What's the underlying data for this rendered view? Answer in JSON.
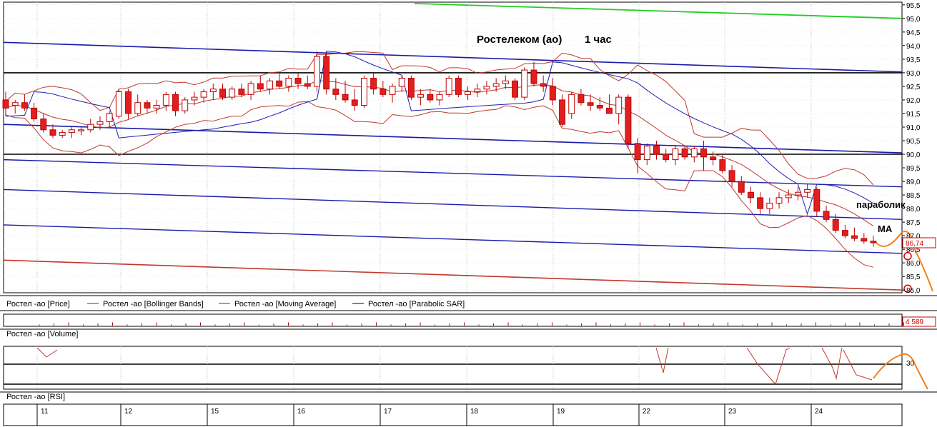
{
  "chart_data": {
    "type": "candlestick",
    "title": "Ростелеком (ао)",
    "timeframe": "1 час",
    "colors": {
      "grid": "#c0c0c0",
      "bb": "#c0392b",
      "sar": "#1f1fb0",
      "channel": "#1a1aa8",
      "level": "#000000",
      "support": "#c0392b",
      "green": "#22cc22",
      "forecast": "#f08020",
      "price_box": "#d00000",
      "up": "#ffffff",
      "down": "#e02020"
    },
    "price_axis": {
      "min": 84.9,
      "max": 95.6,
      "ticks": [
        "95,5",
        "95,0",
        "94,5",
        "94,0",
        "93,5",
        "93,0",
        "92,5",
        "92,0",
        "91,5",
        "91,0",
        "90,5",
        "90,0",
        "89,5",
        "89,0",
        "88,5",
        "88,0",
        "87,5",
        "87,0",
        "86,5",
        "86,0",
        "85,5",
        "85,0"
      ],
      "current_price": "86,74"
    },
    "day_labels": [
      "11",
      "12",
      "15",
      "16",
      "17",
      "18",
      "19",
      "22",
      "23",
      "24"
    ],
    "legend": [
      {
        "label": "Ростел -ао [Price]",
        "color": "#000000"
      },
      {
        "label": "Ростел -ао [Bollinger Bands]",
        "color": "#c0392b"
      },
      {
        "label": "Ростел -ао [Moving Average]",
        "color": "#c0392b"
      },
      {
        "label": "Ростел -ао [Parabolic SAR]",
        "color": "#1f1fb0"
      }
    ],
    "annotations": [
      "параболик",
      "MA"
    ],
    "horizontal_levels": [
      93.0,
      90.0
    ],
    "volume": {
      "label": "Ростел -ао [Volume]",
      "value": "4 589"
    },
    "rsi": {
      "label": "Ростел -ао [RSI]",
      "level": "30"
    },
    "candles": [
      [
        92.0,
        92.3,
        91.4,
        91.7
      ],
      [
        91.8,
        92.0,
        91.5,
        91.9
      ],
      [
        91.9,
        92.2,
        91.6,
        91.7
      ],
      [
        91.7,
        91.9,
        91.2,
        91.3
      ],
      [
        91.3,
        91.5,
        90.8,
        90.9
      ],
      [
        90.9,
        91.1,
        90.6,
        90.7
      ],
      [
        90.7,
        90.9,
        90.6,
        90.8
      ],
      [
        90.8,
        91.0,
        90.6,
        90.9
      ],
      [
        90.9,
        91.0,
        90.7,
        90.9
      ],
      [
        90.9,
        91.3,
        90.8,
        91.1
      ],
      [
        91.1,
        91.4,
        90.9,
        91.2
      ],
      [
        91.2,
        91.6,
        91.0,
        91.5
      ],
      [
        91.4,
        92.4,
        91.3,
        92.3
      ],
      [
        92.3,
        92.4,
        91.3,
        91.5
      ],
      [
        91.5,
        92.2,
        91.4,
        91.9
      ],
      [
        91.9,
        92.0,
        91.5,
        91.7
      ],
      [
        91.7,
        92.0,
        91.5,
        91.8
      ],
      [
        91.8,
        92.3,
        91.6,
        92.2
      ],
      [
        92.2,
        92.3,
        91.4,
        91.6
      ],
      [
        91.6,
        92.1,
        91.5,
        92.0
      ],
      [
        92.0,
        92.3,
        91.8,
        92.1
      ],
      [
        92.1,
        92.4,
        91.9,
        92.3
      ],
      [
        92.3,
        92.6,
        92.0,
        92.4
      ],
      [
        92.4,
        92.6,
        92.0,
        92.1
      ],
      [
        92.1,
        92.5,
        92.0,
        92.4
      ],
      [
        92.4,
        92.6,
        92.1,
        92.2
      ],
      [
        92.2,
        92.7,
        92.0,
        92.6
      ],
      [
        92.6,
        92.9,
        92.3,
        92.4
      ],
      [
        92.4,
        92.8,
        92.2,
        92.7
      ],
      [
        92.7,
        93.0,
        92.4,
        92.5
      ],
      [
        92.5,
        92.9,
        92.3,
        92.8
      ],
      [
        92.8,
        93.0,
        92.4,
        92.6
      ],
      [
        92.6,
        92.9,
        92.4,
        92.5
      ],
      [
        92.5,
        93.8,
        92.3,
        93.6
      ],
      [
        93.6,
        93.7,
        92.2,
        92.4
      ],
      [
        92.4,
        92.8,
        92.0,
        92.2
      ],
      [
        92.2,
        92.7,
        91.9,
        92.0
      ],
      [
        92.0,
        92.4,
        91.6,
        91.8
      ],
      [
        91.8,
        92.9,
        91.7,
        92.8
      ],
      [
        92.8,
        93.0,
        92.2,
        92.4
      ],
      [
        92.4,
        92.7,
        92.1,
        92.2
      ],
      [
        92.2,
        92.6,
        91.9,
        92.5
      ],
      [
        92.5,
        92.9,
        92.3,
        92.8
      ],
      [
        92.8,
        92.9,
        92.0,
        92.1
      ],
      [
        92.1,
        92.4,
        91.8,
        92.2
      ],
      [
        92.2,
        92.4,
        91.9,
        92.0
      ],
      [
        92.0,
        92.3,
        91.8,
        92.2
      ],
      [
        92.2,
        92.9,
        92.1,
        92.8
      ],
      [
        92.8,
        92.9,
        92.1,
        92.2
      ],
      [
        92.2,
        92.5,
        92.0,
        92.3
      ],
      [
        92.3,
        92.6,
        92.1,
        92.4
      ],
      [
        92.4,
        92.7,
        92.2,
        92.5
      ],
      [
        92.5,
        92.8,
        92.3,
        92.6
      ],
      [
        92.6,
        92.9,
        92.4,
        92.7
      ],
      [
        92.7,
        92.8,
        92.0,
        92.1
      ],
      [
        92.1,
        93.2,
        92.0,
        93.1
      ],
      [
        93.1,
        93.4,
        92.5,
        92.6
      ],
      [
        92.6,
        92.9,
        92.3,
        92.5
      ],
      [
        92.5,
        92.8,
        91.8,
        92.0
      ],
      [
        92.0,
        92.2,
        91.0,
        91.1
      ],
      [
        91.5,
        92.3,
        91.3,
        92.2
      ],
      [
        92.2,
        92.4,
        91.8,
        91.9
      ],
      [
        91.9,
        92.2,
        91.6,
        91.8
      ],
      [
        91.8,
        92.1,
        91.6,
        91.7
      ],
      [
        91.7,
        92.2,
        91.5,
        91.5
      ],
      [
        91.5,
        92.2,
        91.1,
        92.1
      ],
      [
        92.1,
        92.2,
        90.2,
        90.4
      ],
      [
        90.4,
        90.6,
        89.3,
        89.8
      ],
      [
        89.8,
        90.4,
        89.6,
        90.3
      ],
      [
        90.3,
        90.5,
        89.8,
        90.0
      ],
      [
        90.0,
        90.2,
        89.7,
        89.8
      ],
      [
        89.8,
        90.3,
        89.6,
        90.2
      ],
      [
        90.2,
        90.3,
        89.8,
        89.9
      ],
      [
        89.9,
        90.3,
        89.7,
        90.2
      ],
      [
        90.2,
        90.5,
        89.4,
        89.9
      ],
      [
        89.9,
        90.1,
        89.6,
        89.8
      ],
      [
        89.8,
        90.0,
        89.3,
        89.4
      ],
      [
        89.4,
        89.6,
        88.8,
        89.0
      ],
      [
        89.0,
        89.2,
        88.5,
        88.6
      ],
      [
        88.6,
        88.8,
        88.2,
        88.4
      ],
      [
        88.4,
        88.6,
        87.8,
        88.0
      ],
      [
        88.0,
        88.4,
        87.8,
        88.2
      ],
      [
        88.2,
        88.6,
        88.0,
        88.4
      ],
      [
        88.4,
        88.7,
        88.2,
        88.5
      ],
      [
        88.5,
        88.8,
        88.3,
        88.6
      ],
      [
        88.6,
        88.9,
        88.4,
        88.7
      ],
      [
        88.7,
        88.8,
        87.7,
        87.9
      ],
      [
        87.9,
        88.1,
        87.5,
        87.6
      ],
      [
        87.6,
        87.8,
        87.1,
        87.2
      ],
      [
        87.2,
        87.4,
        86.9,
        87.0
      ],
      [
        87.0,
        87.3,
        86.8,
        86.9
      ],
      [
        86.9,
        87.1,
        86.7,
        86.8
      ],
      [
        86.8,
        87.0,
        86.6,
        86.74
      ]
    ]
  }
}
